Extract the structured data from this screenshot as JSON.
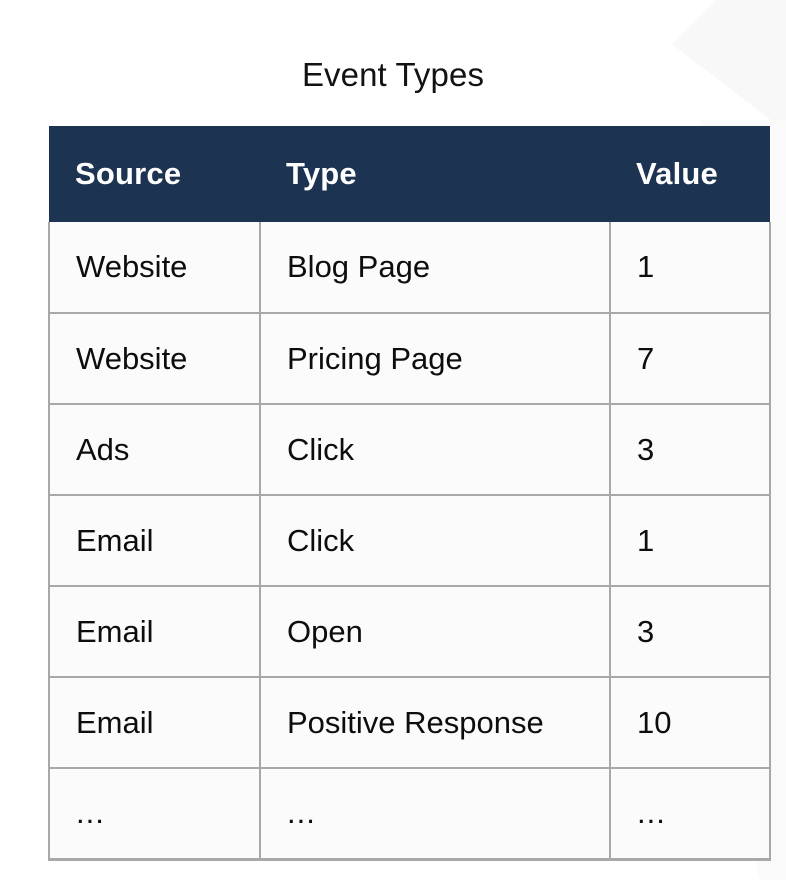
{
  "title": "Event Types",
  "colors": {
    "header_background": "#1c3351",
    "header_text": "#ffffff",
    "grid_line": "#a8a8a8",
    "cell_background": "#fbfbfb",
    "body_text": "#0d0d0d",
    "page_background": "#ffffff",
    "watermark": "#f7f7f7"
  },
  "table": {
    "columns": [
      {
        "key": "source",
        "label": "Source"
      },
      {
        "key": "type",
        "label": "Type"
      },
      {
        "key": "value",
        "label": "Value"
      }
    ],
    "rows": [
      {
        "source": "Website",
        "type": "Blog Page",
        "value": "1"
      },
      {
        "source": "Website",
        "type": "Pricing Page",
        "value": "7"
      },
      {
        "source": "Ads",
        "type": "Click",
        "value": "3"
      },
      {
        "source": "Email",
        "type": "Click",
        "value": "1"
      },
      {
        "source": "Email",
        "type": "Open",
        "value": "3"
      },
      {
        "source": "Email",
        "type": "Positive Response",
        "value": "10"
      },
      {
        "source": "...",
        "type": "...",
        "value": "..."
      }
    ]
  },
  "chart_data": {
    "type": "table",
    "title": "Event Types",
    "columns": [
      "Source",
      "Type",
      "Value"
    ],
    "rows": [
      [
        "Website",
        "Blog Page",
        1
      ],
      [
        "Website",
        "Pricing Page",
        7
      ],
      [
        "Ads",
        "Click",
        3
      ],
      [
        "Email",
        "Click",
        1
      ],
      [
        "Email",
        "Open",
        3
      ],
      [
        "Email",
        "Positive Response",
        10
      ],
      [
        "...",
        "...",
        "..."
      ]
    ],
    "categories": [
      "Blog Page",
      "Pricing Page",
      "Click",
      "Click",
      "Open",
      "Positive Response"
    ],
    "values": [
      1,
      7,
      3,
      1,
      3,
      10
    ],
    "series": [
      {
        "name": "Value",
        "values": [
          1,
          7,
          3,
          1,
          3,
          10
        ]
      }
    ],
    "xlabel": "",
    "ylabel": "Value",
    "legend": [],
    "grid": true,
    "truncated": true
  }
}
